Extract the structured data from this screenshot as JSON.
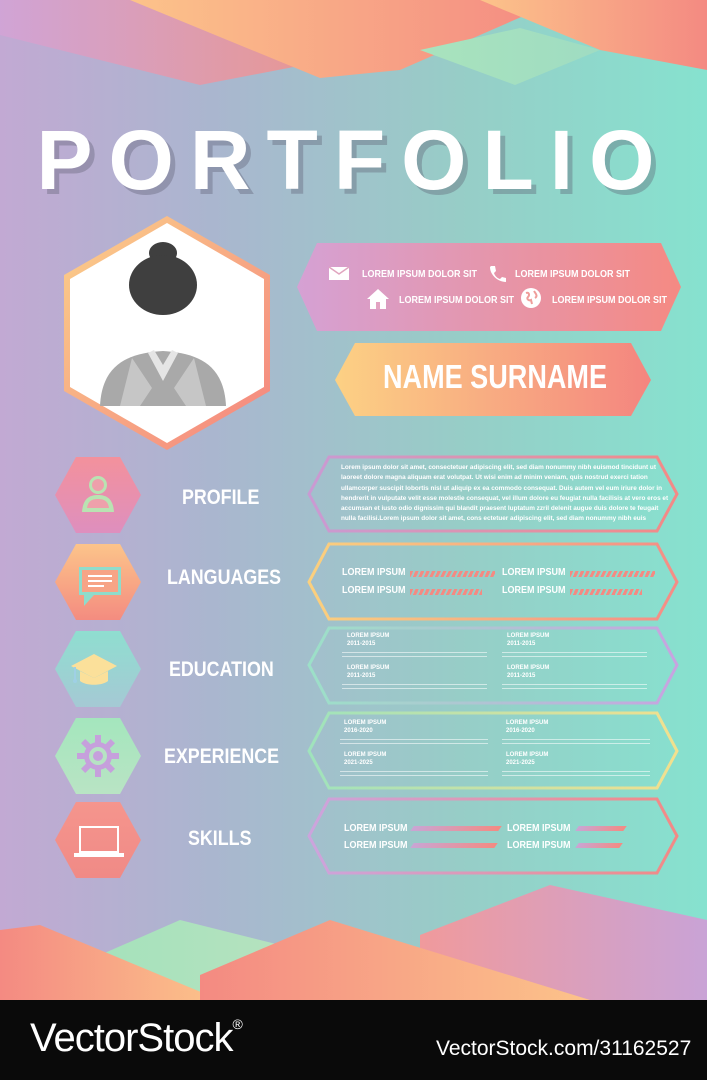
{
  "title": "PORTFOLIO",
  "contact": {
    "email": "LOREM IPSUM DOLOR SIT",
    "phone": "LOREM IPSUM DOLOR SIT",
    "address": "LOREM IPSUM DOLOR SIT",
    "website": "LOREM IPSUM DOLOR SIT"
  },
  "name": "NAME SURNAME",
  "sections": {
    "profile": "PROFILE",
    "languages": "LANGUAGES",
    "education": "EDUCATION",
    "experience": "EXPERIENCE",
    "skills": "SKILLS"
  },
  "profile_text": "Lorem ipsum dolor sit amet, consectetuer adipiscing elit, sed diam nonummy nibh euismod tincidunt ut laoreet dolore magna aliquam erat volutpat. Ut wisi enim ad minim veniam, quis nostrud exerci tation ullamcorper suscipit lobortis nisl ut aliquip ex ea commodo consequat. Duis autem vel eum iriure dolor in hendrerit in vulputate velit esse molestie consequat, vel illum dolore eu feugiat nulla facilisis at vero eros et accumsan et iusto odio dignissim qui blandit praesent luptatum zzril delenit augue duis dolore te feugait nulla facilisi.Lorem ipsum dolor sit amet, cons ectetuer adipiscing elit, sed diam nonummy nibh euis",
  "languages": [
    {
      "label": "LOREM IPSUM",
      "level": 1.0
    },
    {
      "label": "LOREM IPSUM",
      "level": 1.0
    },
    {
      "label": "LOREM IPSUM",
      "level": 0.85
    },
    {
      "label": "LOREM IPSUM",
      "level": 0.85
    }
  ],
  "education": [
    {
      "title": "LOREM IPSUM",
      "years": "2011-2015"
    },
    {
      "title": "LOREM IPSUM",
      "years": "2011-2015"
    },
    {
      "title": "LOREM IPSUM",
      "years": "2011-2015"
    },
    {
      "title": "LOREM IPSUM",
      "years": "2011-2015"
    }
  ],
  "experience": [
    {
      "title": "LOREM IPSUM",
      "years": "2016-2020"
    },
    {
      "title": "LOREM IPSUM",
      "years": "2016-2020"
    },
    {
      "title": "LOREM IPSUM",
      "years": "2021-2025"
    },
    {
      "title": "LOREM IPSUM",
      "years": "2021-2025"
    }
  ],
  "skills": [
    {
      "label": "LOREM IPSUM",
      "level": 1.0
    },
    {
      "label": "LOREM IPSUM",
      "level": 0.6
    },
    {
      "label": "LOREM IPSUM",
      "level": 0.95
    },
    {
      "label": "LOREM IPSUM",
      "level": 0.55
    }
  ],
  "footer": {
    "brand": "VectorStock",
    "reg": "®",
    "url": "VectorStock.com/31162527"
  },
  "colors": {
    "coral": "#f48a82",
    "peach": "#fcc38a",
    "lilac": "#c9a5d4",
    "mint": "#9fe0bf",
    "teal": "#86e2cf"
  }
}
